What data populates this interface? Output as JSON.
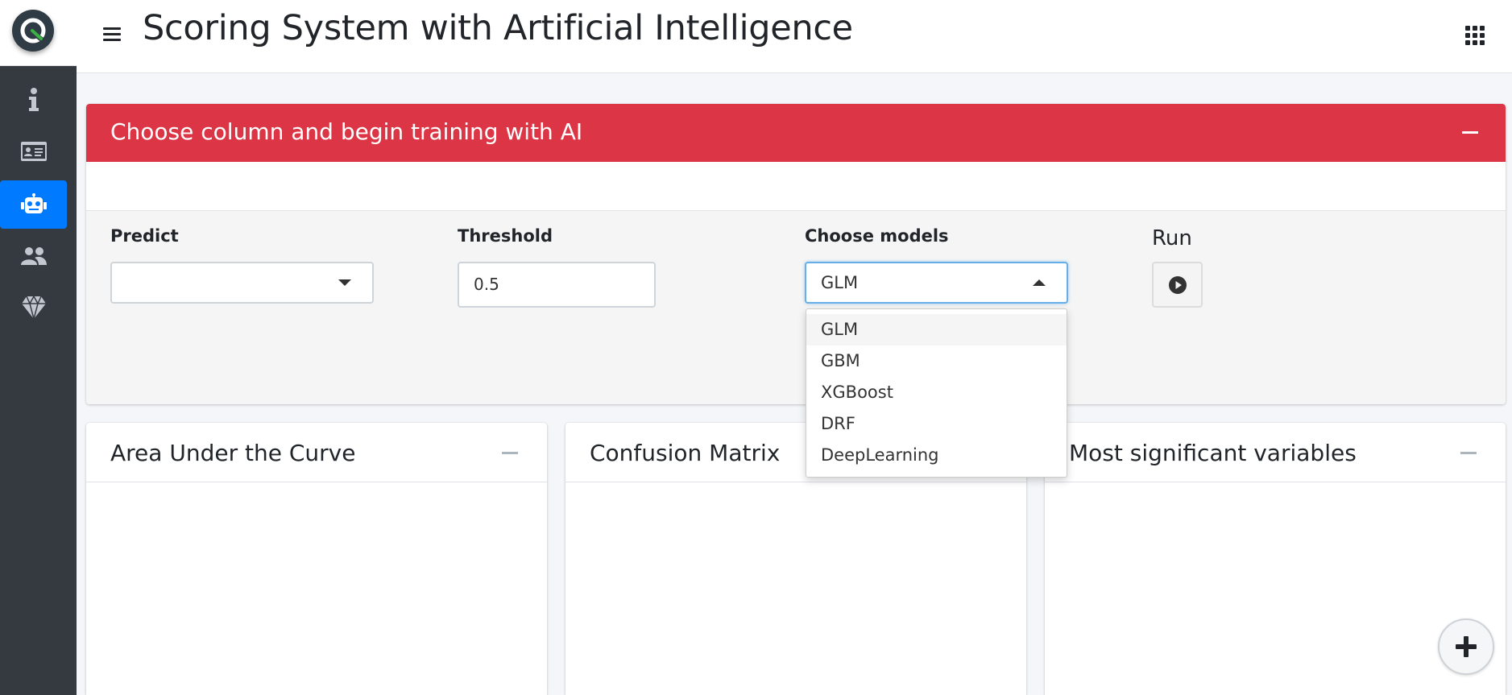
{
  "header": {
    "title": "Scoring System with Artificial Intelligence",
    "menu_icon": "hamburger-icon",
    "apps_icon": "grid-icon"
  },
  "sidebar": {
    "logo_icon": "app-logo-icon",
    "items": [
      {
        "icon": "info-icon",
        "active": false
      },
      {
        "icon": "id-card-icon",
        "active": false
      },
      {
        "icon": "robot-icon",
        "active": true
      },
      {
        "icon": "users-icon",
        "active": false
      },
      {
        "icon": "gem-icon",
        "active": false
      }
    ]
  },
  "training_card": {
    "title": "Choose column and begin training with AI",
    "color": "#dc3545",
    "predict": {
      "label": "Predict",
      "value": ""
    },
    "threshold": {
      "label": "Threshold",
      "value": "0.5"
    },
    "models": {
      "label": "Choose models",
      "value": "GLM",
      "open": true,
      "options": [
        "GLM",
        "GBM",
        "XGBoost",
        "DRF",
        "DeepLearning"
      ],
      "highlighted": "GLM"
    },
    "run": {
      "label": "Run",
      "icon": "play-circle-icon"
    }
  },
  "result_cards": [
    {
      "title": "Area Under the Curve"
    },
    {
      "title": "Confusion Matrix"
    },
    {
      "title": "Most significant variables"
    }
  ],
  "fab": {
    "icon": "plus-icon"
  },
  "colors": {
    "accent": "#007bff",
    "sidebar": "#343a40",
    "danger": "#dc3545"
  }
}
